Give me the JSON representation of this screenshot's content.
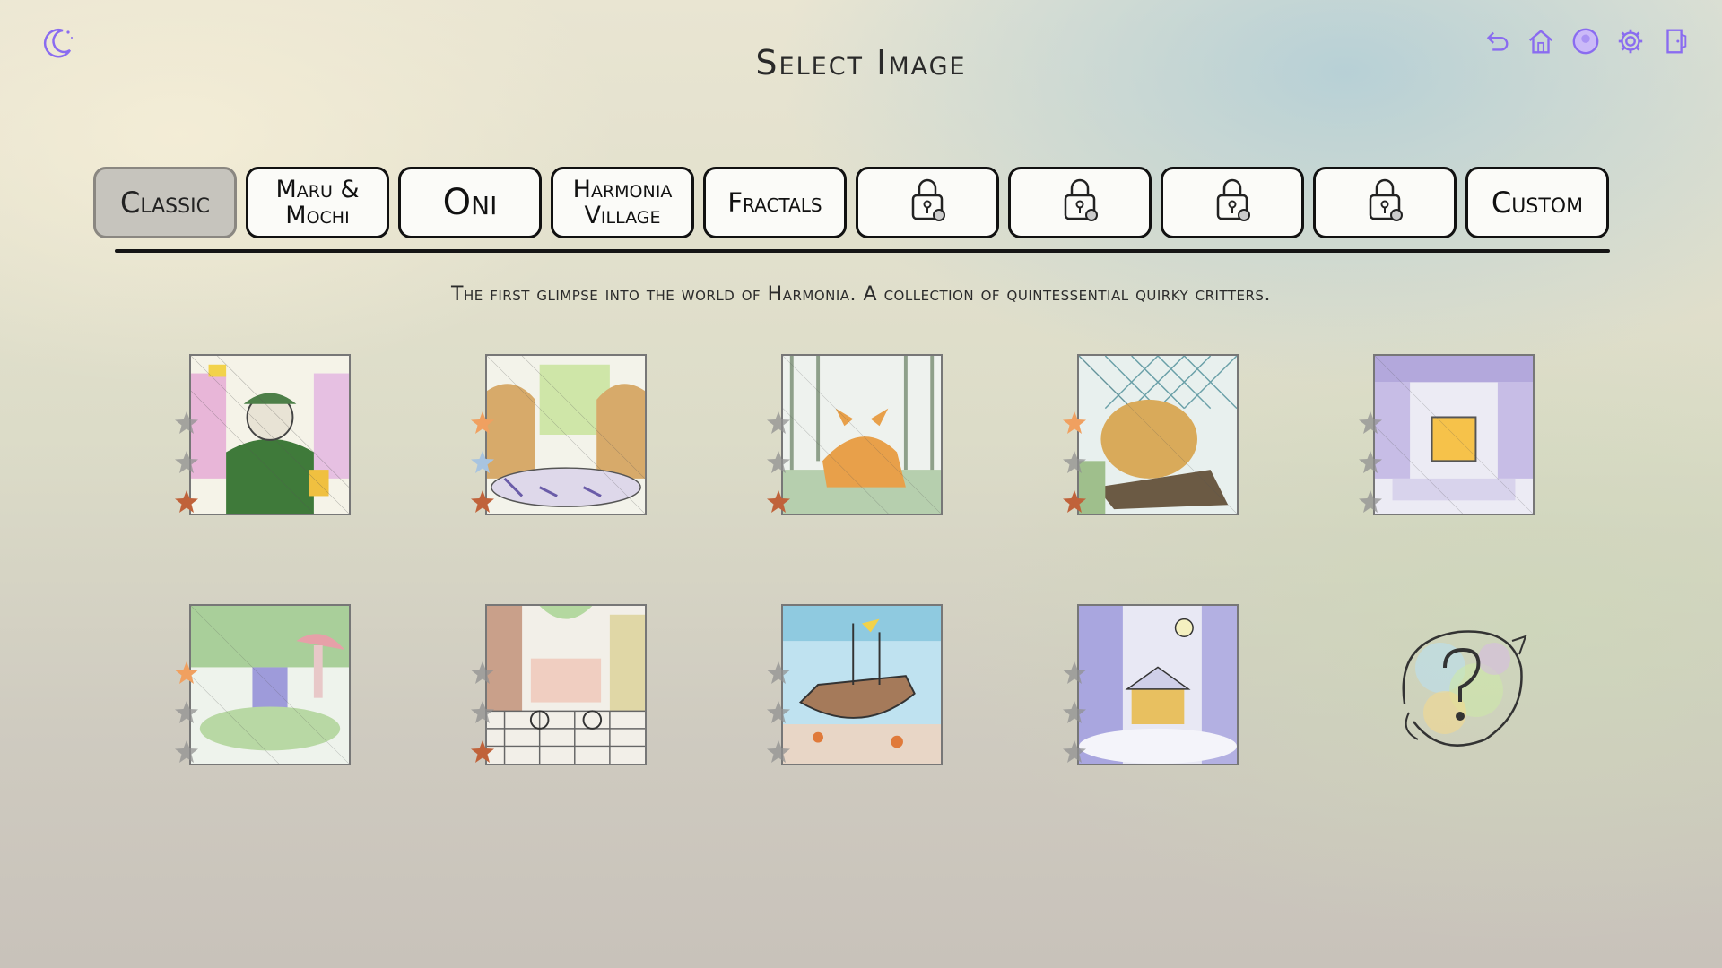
{
  "title": "Select Image",
  "top_icons": [
    {
      "name": "undo-icon"
    },
    {
      "name": "home-icon"
    },
    {
      "name": "profile-icon"
    },
    {
      "name": "settings-icon"
    },
    {
      "name": "exit-icon"
    }
  ],
  "tabs": [
    {
      "label": "Classic",
      "selected": true,
      "locked": false
    },
    {
      "label": "Maru & Mochi",
      "selected": false,
      "locked": false
    },
    {
      "label": "Oni",
      "selected": false,
      "locked": false
    },
    {
      "label": "Harmonia Village",
      "selected": false,
      "locked": false
    },
    {
      "label": "Fractals",
      "selected": false,
      "locked": false
    },
    {
      "label": "",
      "icon": "lock-key-icon",
      "selected": false,
      "locked": true
    },
    {
      "label": "",
      "icon": "lock-key-icon",
      "selected": false,
      "locked": true
    },
    {
      "label": "",
      "icon": "lock-key-icon",
      "selected": false,
      "locked": true
    },
    {
      "label": "",
      "icon": "lock-key-icon",
      "selected": false,
      "locked": true
    },
    {
      "label": "Custom",
      "selected": false,
      "locked": false
    }
  ],
  "description": "The first glimpse into the world of Harmonia. A collection of quintessential quirky critters.",
  "colors": {
    "star_gold": "#f0a060",
    "star_silver": "#a8c4e0",
    "star_bronze": "#c0623a",
    "star_empty": "#909090",
    "accent_icon": "#8a6cf0"
  },
  "images": [
    {
      "id": "cat-shopkeeper",
      "stars": [
        "empty",
        "empty",
        "bronze"
      ]
    },
    {
      "id": "highland-cows",
      "stars": [
        "gold",
        "silver",
        "bronze"
      ]
    },
    {
      "id": "forest-fox",
      "stars": [
        "empty",
        "empty",
        "bronze"
      ]
    },
    {
      "id": "greenhouse-lion",
      "stars": [
        "gold",
        "empty",
        "bronze"
      ]
    },
    {
      "id": "library-room",
      "stars": [
        "empty",
        "empty",
        "empty"
      ]
    },
    {
      "id": "mushroom-grove",
      "stars": [
        "gold",
        "empty",
        "empty"
      ]
    },
    {
      "id": "market-street",
      "stars": [
        "empty",
        "empty",
        "bronze"
      ]
    },
    {
      "id": "sunken-ship",
      "stars": [
        "empty",
        "empty",
        "empty"
      ]
    },
    {
      "id": "winter-cabin",
      "stars": [
        "empty",
        "empty",
        "empty"
      ]
    },
    {
      "id": "random-surprise",
      "icon": "question-mark-icon"
    }
  ]
}
